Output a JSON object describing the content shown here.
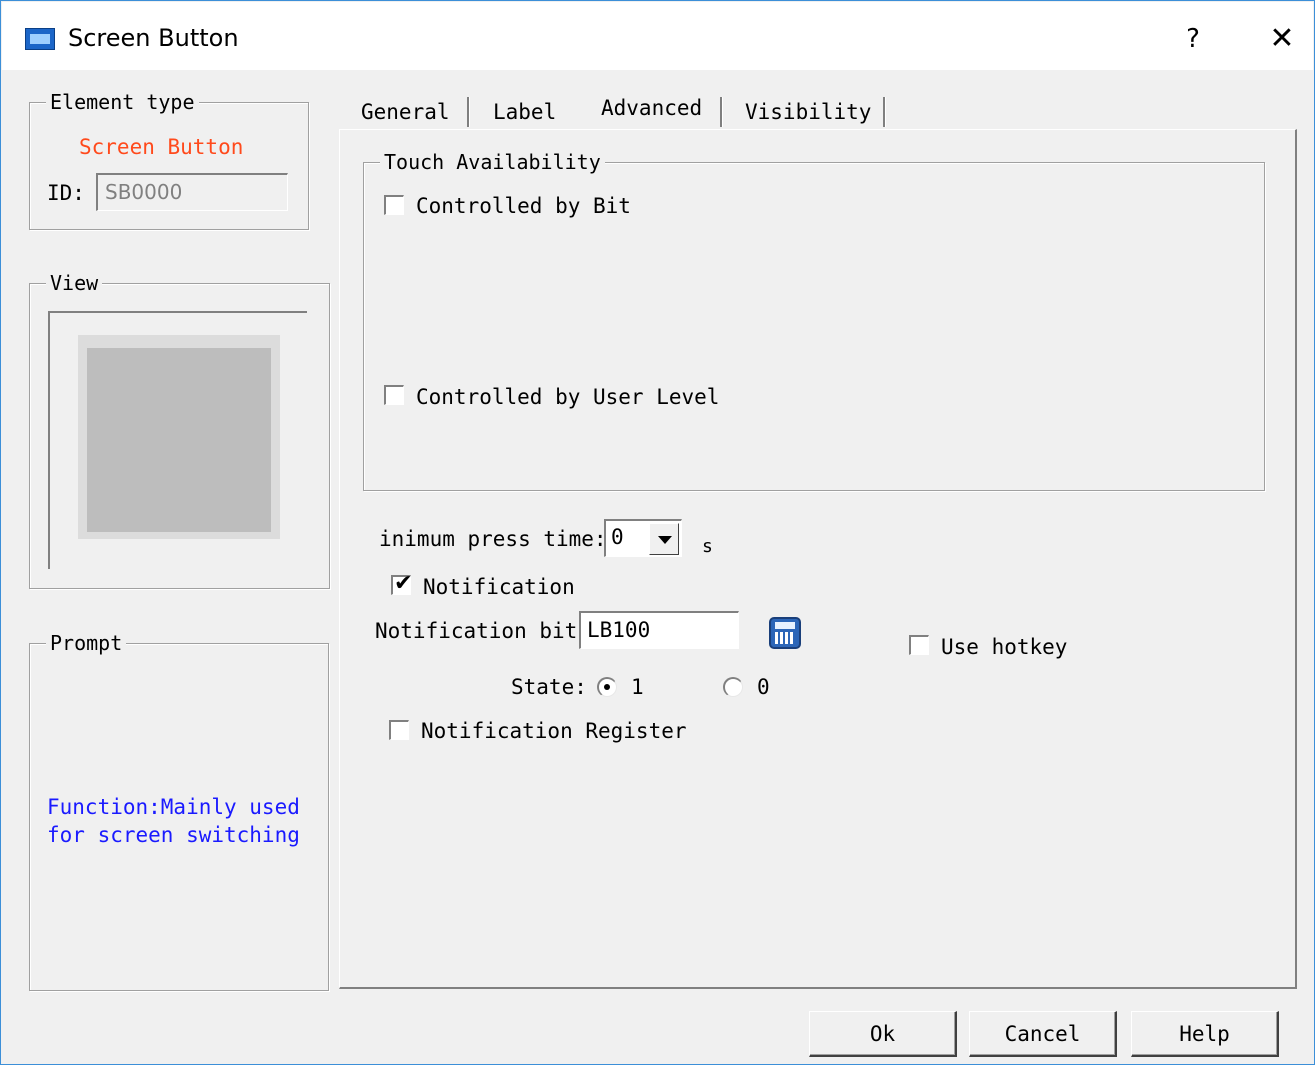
{
  "window": {
    "title": "Screen Button",
    "help_glyph": "?",
    "close_glyph": "✕"
  },
  "element_type": {
    "group_label": "Element type",
    "name": "Screen Button",
    "name_color": "#ff4a1c",
    "id_label": "ID:",
    "id_value": "SB0000"
  },
  "view": {
    "group_label": "View"
  },
  "prompt": {
    "group_label": "Prompt",
    "line1": "Function:Mainly used",
    "line2": "for screen switching",
    "text_color": "#1a1aff"
  },
  "tabs": [
    {
      "label": "General",
      "active": false
    },
    {
      "label": "Label",
      "active": false
    },
    {
      "label": "Advanced",
      "active": true
    },
    {
      "label": "Visibility",
      "active": false
    }
  ],
  "touch_availability": {
    "group_label": "Touch Availability",
    "controlled_by_bit": {
      "label": "Controlled by Bit",
      "checked": false
    },
    "controlled_by_user_level": {
      "label": "Controlled by User Level",
      "checked": false
    }
  },
  "min_press": {
    "label": "inimum press time:",
    "value": "0",
    "unit": "s"
  },
  "notification": {
    "label": "Notification",
    "checked": true,
    "bit_label": "Notification bit:",
    "bit_value": "LB100",
    "state_label": "State:",
    "state_options": [
      "1",
      "0"
    ],
    "state_selected": "1"
  },
  "use_hotkey": {
    "label": "Use hotkey",
    "checked": false
  },
  "notification_register": {
    "label": "Notification Register",
    "checked": false
  },
  "buttons": {
    "ok": "Ok",
    "cancel": "Cancel",
    "help": "Help"
  }
}
